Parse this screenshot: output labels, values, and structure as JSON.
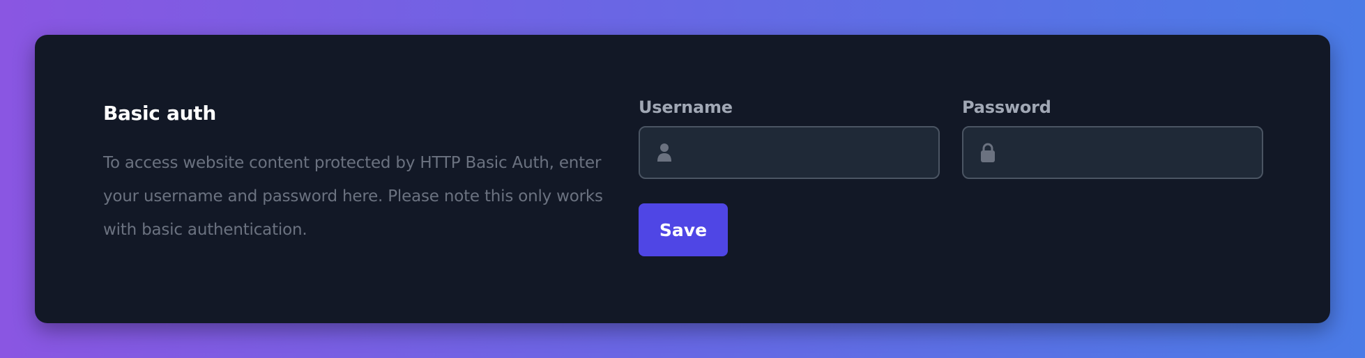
{
  "section": {
    "title": "Basic auth",
    "description": "To access website content protected by HTTP Basic Auth, enter your username and password here. Please note this only works with basic authentication."
  },
  "form": {
    "username": {
      "label": "Username",
      "value": "",
      "placeholder": "",
      "icon": "user-icon"
    },
    "password": {
      "label": "Password",
      "value": "",
      "placeholder": "",
      "icon": "lock-icon"
    },
    "save_label": "Save"
  },
  "colors": {
    "accent": "#4f46e5",
    "card_background": "#121826",
    "input_background": "#1f2937"
  }
}
